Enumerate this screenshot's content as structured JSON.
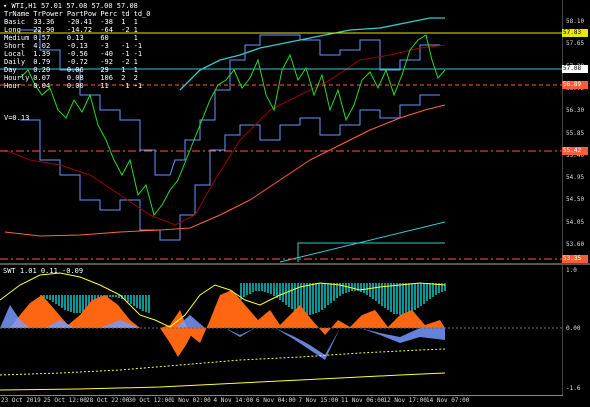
{
  "main_chart": {
    "title": "WTI,H1  57.01 57.08 57.00 57.08",
    "table": {
      "header": [
        "TrName",
        "TrPower",
        "PartPow",
        "Perc",
        "td",
        "td_0"
      ],
      "rows": [
        [
          "Basic",
          "33.36",
          "-20.41",
          "-38",
          "1",
          "1"
        ],
        [
          "Long",
          "22.90",
          "-14.72",
          "-64",
          "-2",
          "1"
        ],
        [
          "Medium",
          "0.57",
          "0.13",
          "60",
          "",
          "1"
        ],
        [
          "Short",
          "4.02",
          "-0.13",
          "-3",
          "-1",
          "-1"
        ],
        [
          "Local",
          "1.39",
          "-0.56",
          "-40",
          "-1",
          "-1"
        ],
        [
          "Daily",
          "0.79",
          "-0.72",
          "-92",
          "-2",
          "1"
        ],
        [
          "Day",
          "0.20",
          "0.06",
          "29",
          "1",
          "1"
        ],
        [
          "Hourly",
          "0.07",
          "0.08",
          "106",
          "2",
          "2"
        ],
        [
          "Hour",
          "0.04",
          "0.00",
          "11",
          "-1",
          "-1"
        ]
      ],
      "footer": "V=0.13"
    },
    "y_ticks": [
      "58.10",
      "57.65",
      "57.20",
      "56.75",
      "56.30",
      "55.85",
      "55.40",
      "54.95",
      "54.50",
      "54.05",
      "53.60"
    ],
    "price_tags": [
      {
        "text": "57.83",
        "color": "#e8e800",
        "kind": "level"
      },
      {
        "text": "57.08",
        "color": "#ffffff",
        "kind": "bid"
      },
      {
        "text": "56.89",
        "color": "#ff5a3a",
        "kind": "line"
      },
      {
        "text": "55.42",
        "color": "#ff5a3a",
        "kind": "line"
      },
      {
        "text": "53.35",
        "color": "#ff5a3a",
        "kind": "line"
      }
    ]
  },
  "sub_chart": {
    "title": "SWT 1.01 0.11 -0.09",
    "y_ticks": [
      "1.0",
      "0.00",
      "-1.6"
    ]
  },
  "x_axis": {
    "labels": [
      "23 Oct 2019",
      "25 Oct 12:00",
      "28 Oct 22:00",
      "30 Oct 12:00",
      "1 Nov 02:00",
      "4 Nov 14:00",
      "6 Nov 04:00",
      "7 Nov 15:00",
      "11 Nov 06:00",
      "12 Nov 17:00",
      "14 Nov 07:00"
    ]
  },
  "colors": {
    "background": "#000000",
    "price": "#22dd22",
    "channel": "#6699ff",
    "ma_slow": "#ff6633",
    "ma_fast": "#990000",
    "cyan": "#33cccc",
    "yellow": "#ffff33",
    "orange": "#ff6611",
    "teal": "#009999",
    "lightblue": "#7799ff"
  }
}
